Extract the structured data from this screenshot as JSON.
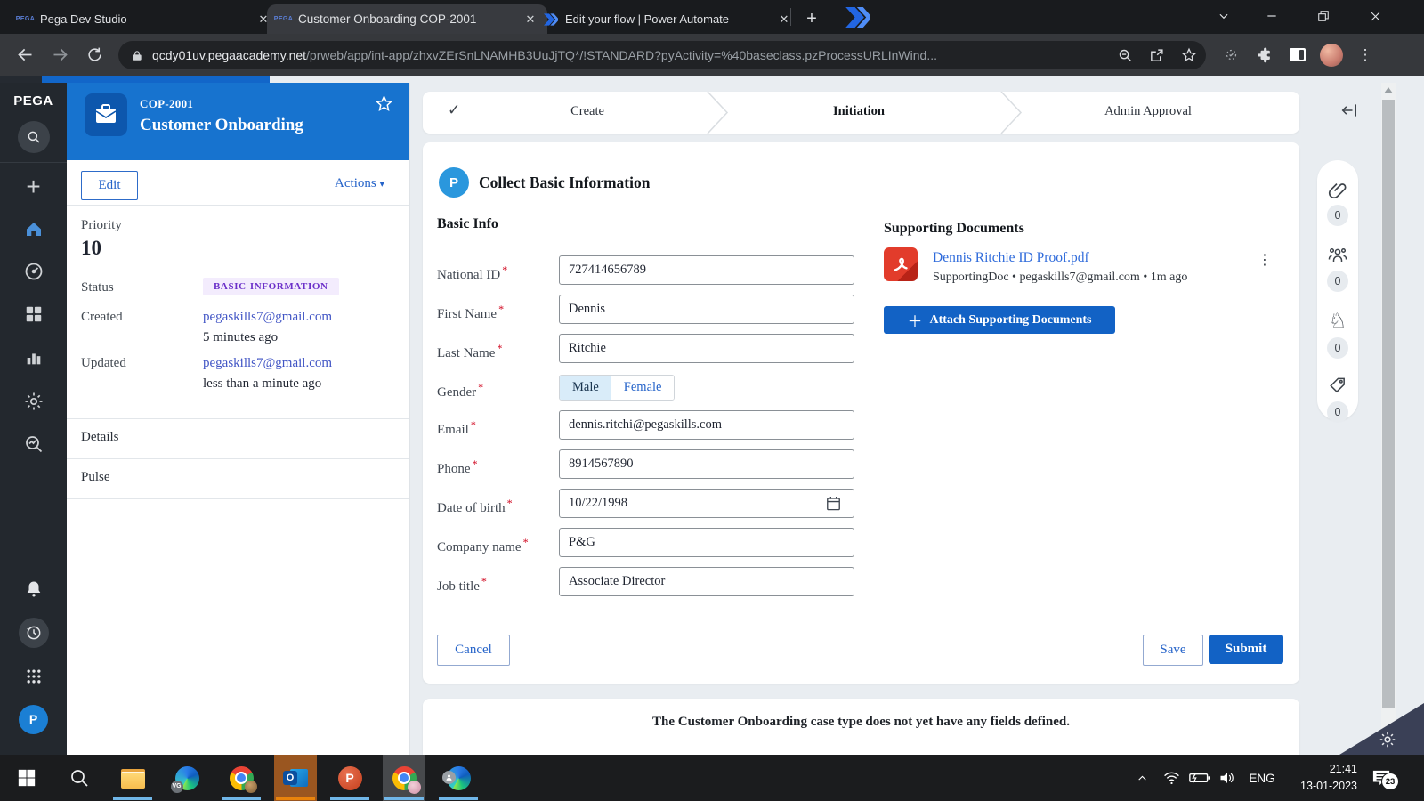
{
  "browser": {
    "tabs": [
      {
        "title": "Pega Dev Studio"
      },
      {
        "title": "Customer Onboarding COP-2001"
      },
      {
        "title": "Edit your flow | Power Automate"
      }
    ],
    "url_domain": "qcdy01uv.pegaacademy.net",
    "url_path": "/prweb/app/int-app/zhxvZErSnLNAMHB3UuJjTQ*/!STANDARD?pyActivity=%40baseclass.pzProcessURLInWind..."
  },
  "sidebar": {
    "logo": "PEGA",
    "avatar_initial": "P"
  },
  "case_panel": {
    "case_id": "COP-2001",
    "case_type": "Customer Onboarding",
    "edit_label": "Edit",
    "actions_label": "Actions",
    "priority_label": "Priority",
    "priority_value": "10",
    "status_label": "Status",
    "status_value": "BASIC-INFORMATION",
    "created_label": "Created",
    "created_by": "pegaskills7@gmail.com",
    "created_when": "5 minutes ago",
    "updated_label": "Updated",
    "updated_by": "pegaskills7@gmail.com",
    "updated_when": "less than a minute ago",
    "tabs": [
      "Details",
      "Pulse"
    ]
  },
  "stages": {
    "items": [
      {
        "label": "Create",
        "state": "done"
      },
      {
        "label": "Initiation",
        "state": "current"
      },
      {
        "label": "Admin Approval",
        "state": "future"
      }
    ]
  },
  "form": {
    "assignment_title": "Collect Basic Information",
    "avatar_initial": "P",
    "section_title": "Basic Info",
    "fields": [
      {
        "label": "National ID",
        "required": true,
        "value": "727414656789"
      },
      {
        "label": "First Name",
        "required": true,
        "value": "Dennis"
      },
      {
        "label": "Last Name",
        "required": true,
        "value": "Ritchie"
      },
      {
        "label": "Gender",
        "required": true,
        "value": "Male",
        "options": [
          "Male",
          "Female"
        ]
      },
      {
        "label": "Email",
        "required": true,
        "value": "dennis.ritchi@pegaskills.com"
      },
      {
        "label": "Phone",
        "required": true,
        "value": "8914567890"
      },
      {
        "label": "Date of birth",
        "required": true,
        "value": "10/22/1998"
      },
      {
        "label": "Company name",
        "required": true,
        "value": "P&G"
      },
      {
        "label": "Job title",
        "required": true,
        "value": "Associate Director"
      }
    ],
    "cancel_label": "Cancel",
    "save_label": "Save",
    "submit_label": "Submit"
  },
  "documents": {
    "title": "Supporting Documents",
    "file_name": "Dennis Ritchie ID Proof.pdf",
    "file_meta": "SupportingDoc  •  pegaskills7@gmail.com  •  1m ago",
    "attach_label": "Attach Supporting Documents"
  },
  "utility_rail": {
    "items": [
      {
        "icon": "paperclip",
        "count": "0"
      },
      {
        "icon": "people",
        "count": "0"
      },
      {
        "icon": "knight",
        "count": "0"
      },
      {
        "icon": "tag",
        "count": "0"
      }
    ]
  },
  "empty_card_text": "The Customer Onboarding case type does not yet have any fields defined.",
  "taskbar": {
    "language": "ENG",
    "time": "21:41",
    "date": "13-01-2023",
    "notification_count": "23"
  },
  "colors": {
    "case_header_blue": "#1773cf",
    "submit_blue": "#1262c5",
    "status_badge_purple": "#6b30c9",
    "link_indigo": "#4155c5",
    "link_blue": "#2563c9",
    "tab_group_blue": "#2266e3",
    "outlook_flash_orange": "#e8830c"
  }
}
